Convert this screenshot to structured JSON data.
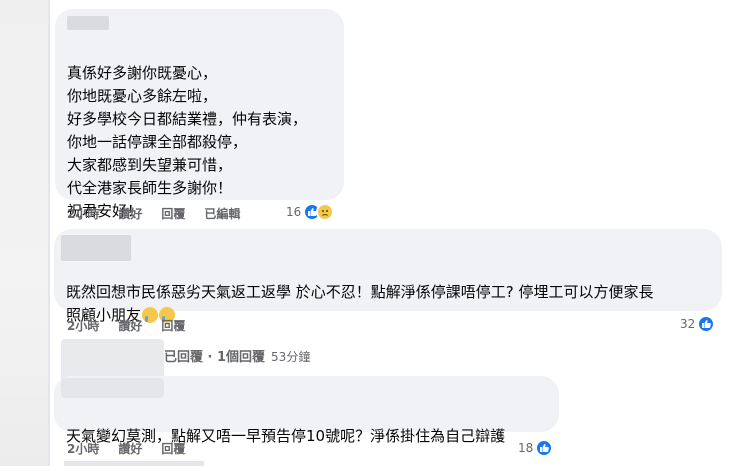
{
  "comments": [
    {
      "lines": [
        "真係好多謝你既憂心，",
        "你地既憂心多餘左啦，",
        "好多學校今日都結業禮，仲有表演，",
        "你地一話停課全部都殺停，",
        "大家都感到失望兼可惜，",
        "代全港家長師生多謝你！",
        "祝君安好！"
      ],
      "time": "2小時",
      "like_label": "讚好",
      "reply_label": "回覆",
      "edited_label": "已編輯",
      "reaction_count": "16"
    },
    {
      "lines": [
        "既然回想市民係惡劣天氣返工返學 於心不忍！點解淨係停課唔停工? 停埋工可以方便家長",
        "照顧小朋友"
      ],
      "time": "2小時",
      "like_label": "讚好",
      "reply_label": "回覆",
      "reaction_count": "32"
    },
    {
      "reply_header": "已回覆 · 1個回覆",
      "reply_header_time": "53分鐘",
      "lines": [
        "天氣變幻莫測，點解又唔一早預告停10號呢？淨係掛住為自己辯護"
      ],
      "time": "2小時",
      "like_label": "讚好",
      "reply_label": "回覆",
      "reaction_count": "18"
    }
  ],
  "colors": {
    "bubble": "#f0f2f5",
    "like": "#1877f2",
    "meta": "#65676b"
  },
  "icons": {
    "like": "thumbs-up-icon",
    "sad": "sad-face-icon",
    "cry": "crying-face-icon"
  }
}
